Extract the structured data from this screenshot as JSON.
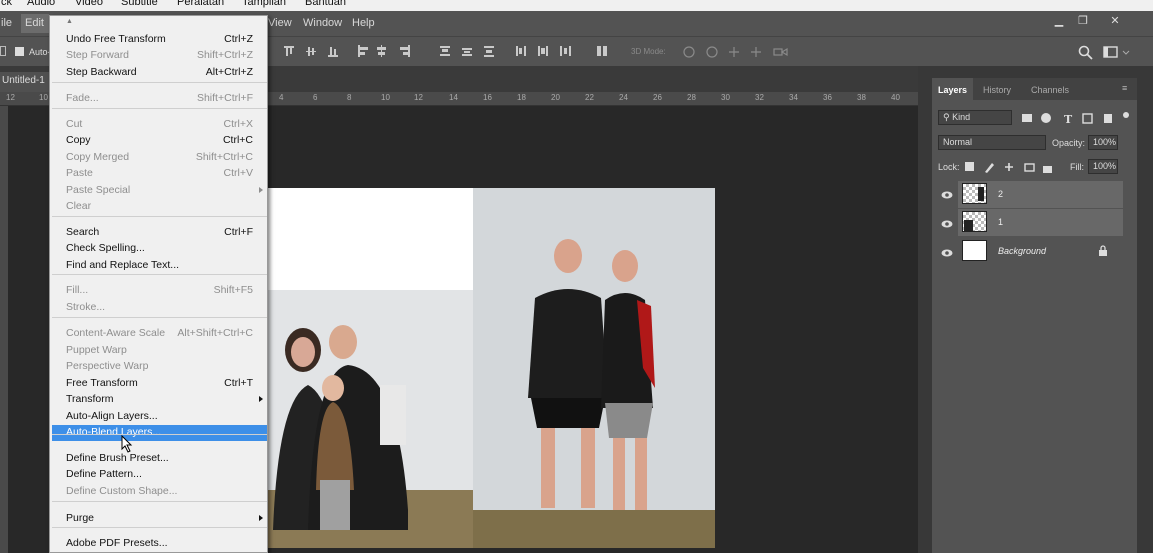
{
  "os_menu": [
    "ck",
    "Audio",
    "Video",
    "Subtitle",
    "Peralatan",
    "Tampilan",
    "Bantuan"
  ],
  "app_menu": {
    "file": "ile",
    "edit": "Edit",
    "view": "View",
    "window": "Window",
    "help": "Help"
  },
  "window_controls": {
    "minimize": "▁",
    "restore": "❐",
    "close": "✕"
  },
  "options_bar": {
    "auto_select": "Auto-",
    "mode_3d": "3D Mode:"
  },
  "document": {
    "tab_title": "Untitled-1"
  },
  "ruler_numbers": [
    "12",
    "10",
    "4",
    "6",
    "8",
    "10",
    "12",
    "14",
    "16",
    "18",
    "20",
    "22",
    "24",
    "26",
    "28",
    "30",
    "32",
    "34",
    "36",
    "38",
    "40"
  ],
  "edit_menu": {
    "scroll_up": "▲",
    "items": [
      {
        "label": "Undo Free Transform",
        "shortcut": "Ctrl+Z",
        "enabled": true
      },
      {
        "label": "Step Forward",
        "shortcut": "Shift+Ctrl+Z",
        "enabled": false
      },
      {
        "label": "Step Backward",
        "shortcut": "Alt+Ctrl+Z",
        "enabled": true
      },
      {
        "label": "Fade...",
        "shortcut": "Shift+Ctrl+F",
        "enabled": false
      },
      {
        "label": "Cut",
        "shortcut": "Ctrl+X",
        "enabled": false
      },
      {
        "label": "Copy",
        "shortcut": "Ctrl+C",
        "enabled": true
      },
      {
        "label": "Copy Merged",
        "shortcut": "Shift+Ctrl+C",
        "enabled": false
      },
      {
        "label": "Paste",
        "shortcut": "Ctrl+V",
        "enabled": false
      },
      {
        "label": "Paste Special",
        "shortcut": "",
        "enabled": false,
        "submenu": true
      },
      {
        "label": "Clear",
        "shortcut": "",
        "enabled": false
      },
      {
        "label": "Search",
        "shortcut": "Ctrl+F",
        "enabled": true
      },
      {
        "label": "Check Spelling...",
        "shortcut": "",
        "enabled": true
      },
      {
        "label": "Find and Replace Text...",
        "shortcut": "",
        "enabled": true
      },
      {
        "label": "Fill...",
        "shortcut": "Shift+F5",
        "enabled": false
      },
      {
        "label": "Stroke...",
        "shortcut": "",
        "enabled": false
      },
      {
        "label": "Content-Aware Scale",
        "shortcut": "Alt+Shift+Ctrl+C",
        "enabled": false
      },
      {
        "label": "Puppet Warp",
        "shortcut": "",
        "enabled": false
      },
      {
        "label": "Perspective Warp",
        "shortcut": "",
        "enabled": false
      },
      {
        "label": "Free Transform",
        "shortcut": "Ctrl+T",
        "enabled": true
      },
      {
        "label": "Transform",
        "shortcut": "",
        "enabled": true,
        "submenu": true
      },
      {
        "label": "Auto-Align Layers...",
        "shortcut": "",
        "enabled": true
      },
      {
        "label": "Auto-Blend Layers...",
        "shortcut": "",
        "enabled": true,
        "highlighted": true
      },
      {
        "label": "Define Brush Preset...",
        "shortcut": "",
        "enabled": true
      },
      {
        "label": "Define Pattern...",
        "shortcut": "",
        "enabled": true
      },
      {
        "label": "Define Custom Shape...",
        "shortcut": "",
        "enabled": false
      },
      {
        "label": "Purge",
        "shortcut": "",
        "enabled": true,
        "submenu": true
      },
      {
        "label": "Adobe PDF Presets...",
        "shortcut": "",
        "enabled": true
      }
    ]
  },
  "panels": {
    "tabs": [
      "Layers",
      "History",
      "Channels"
    ],
    "filter_kind": "Kind",
    "blend_mode": "Normal",
    "opacity_label": "Opacity:",
    "opacity_value": "100%",
    "lock_label": "Lock:",
    "fill_label": "Fill:",
    "fill_value": "100%",
    "layers": [
      {
        "name": "2",
        "selected": true
      },
      {
        "name": "1",
        "selected": true
      },
      {
        "name": "Background",
        "selected": false,
        "locked": true
      }
    ]
  },
  "colors": {
    "highlight": "#3d8fe8",
    "menu_bg": "#f0f0f0",
    "panel_bg": "#535353",
    "canvas_bg": "#282828"
  }
}
